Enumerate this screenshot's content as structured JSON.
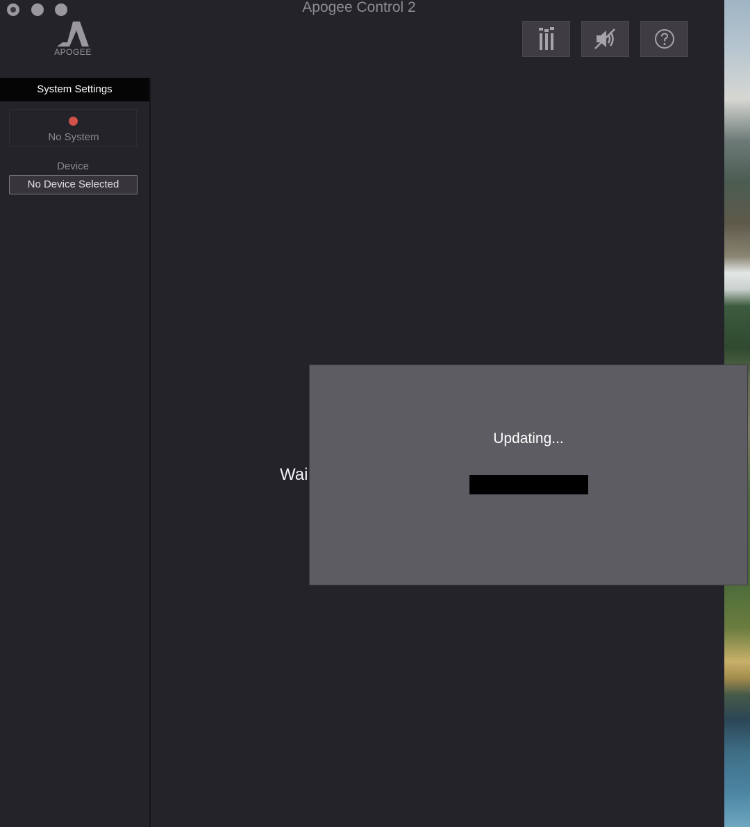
{
  "window": {
    "title": "Apogee Control 2"
  },
  "logo": {
    "text": "APOGEE"
  },
  "toolbar": {
    "buttons": [
      {
        "icon": "mixer-icon"
      },
      {
        "icon": "mute-speaker-icon"
      },
      {
        "icon": "help-icon"
      }
    ]
  },
  "sidebar": {
    "header": "System Settings",
    "system_status": "No System",
    "status_color": "#d2514a",
    "device_label": "Device",
    "device_value": "No Device Selected"
  },
  "main": {
    "background_text": "Wai"
  },
  "dialog": {
    "title": "Updating...",
    "progress": 0
  }
}
